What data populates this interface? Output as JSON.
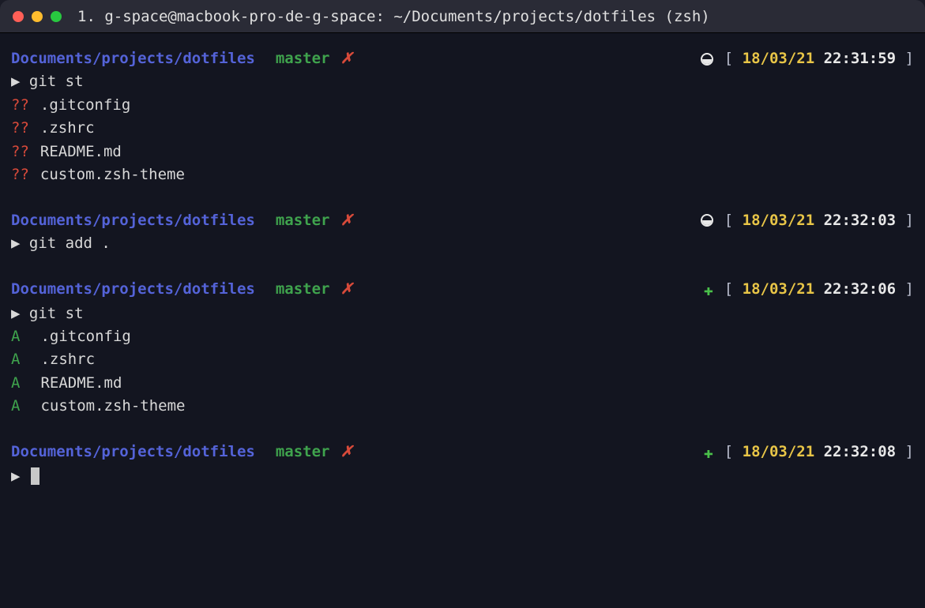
{
  "window": {
    "title": "1. g-space@macbook-pro-de-g-space: ~/Documents/projects/dotfiles (zsh)"
  },
  "blocks": [
    {
      "path": "Documents/projects/dotfiles",
      "branch": "master",
      "dirty": "✗",
      "status_icon": "half",
      "date": "18/03/21",
      "time": "22:31:59",
      "command": "git st",
      "output": [
        {
          "mark": "??",
          "mark_class": "untracked",
          "file": ".gitconfig"
        },
        {
          "mark": "??",
          "mark_class": "untracked",
          "file": ".zshrc"
        },
        {
          "mark": "??",
          "mark_class": "untracked",
          "file": "README.md"
        },
        {
          "mark": "??",
          "mark_class": "untracked",
          "file": "custom.zsh-theme"
        }
      ]
    },
    {
      "path": "Documents/projects/dotfiles",
      "branch": "master",
      "dirty": "✗",
      "status_icon": "half",
      "date": "18/03/21",
      "time": "22:32:03",
      "command": "git add .",
      "output": []
    },
    {
      "path": "Documents/projects/dotfiles",
      "branch": "master",
      "dirty": "✗",
      "status_icon": "plus",
      "date": "18/03/21",
      "time": "22:32:06",
      "command": "git st",
      "output": [
        {
          "mark": "A",
          "mark_class": "added",
          "file": ".gitconfig"
        },
        {
          "mark": "A",
          "mark_class": "added",
          "file": ".zshrc"
        },
        {
          "mark": "A",
          "mark_class": "added",
          "file": "README.md"
        },
        {
          "mark": "A",
          "mark_class": "added",
          "file": "custom.zsh-theme"
        }
      ]
    },
    {
      "path": "Documents/projects/dotfiles",
      "branch": "master",
      "dirty": "✗",
      "status_icon": "plus",
      "date": "18/03/21",
      "time": "22:32:08",
      "command": "",
      "cursor": true,
      "output": []
    }
  ],
  "glyphs": {
    "prompt_marker": "▶",
    "plus": "✚",
    "bracket_open": "[",
    "bracket_close": "]"
  }
}
